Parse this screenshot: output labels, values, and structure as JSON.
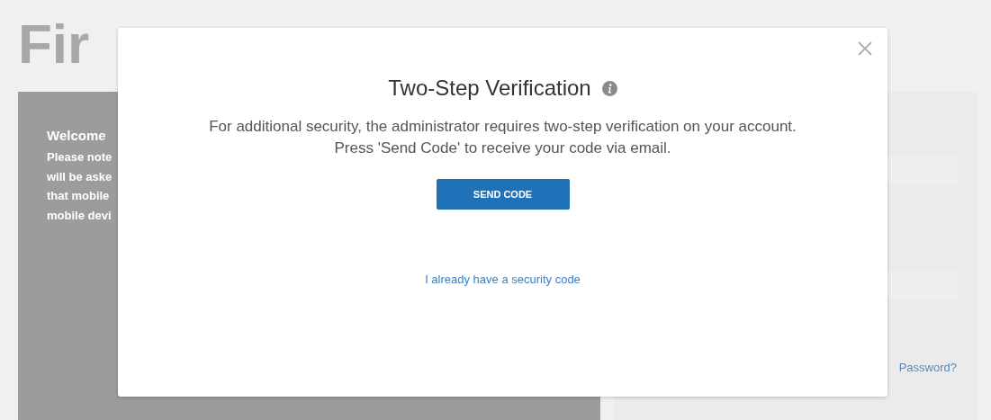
{
  "background": {
    "logo": "Fir",
    "welcome_lines": [
      "Welcome",
      "Please note",
      "will be aske",
      "that mobile",
      "mobile devi"
    ],
    "forgot_link": "Password?"
  },
  "dialog": {
    "title": "Two-Step Verification",
    "message": "For additional security, the administrator requires two-step verification on your account. Press 'Send Code' to receive your code via email.",
    "button": "SEND CODE",
    "link": "I already have a security code"
  }
}
